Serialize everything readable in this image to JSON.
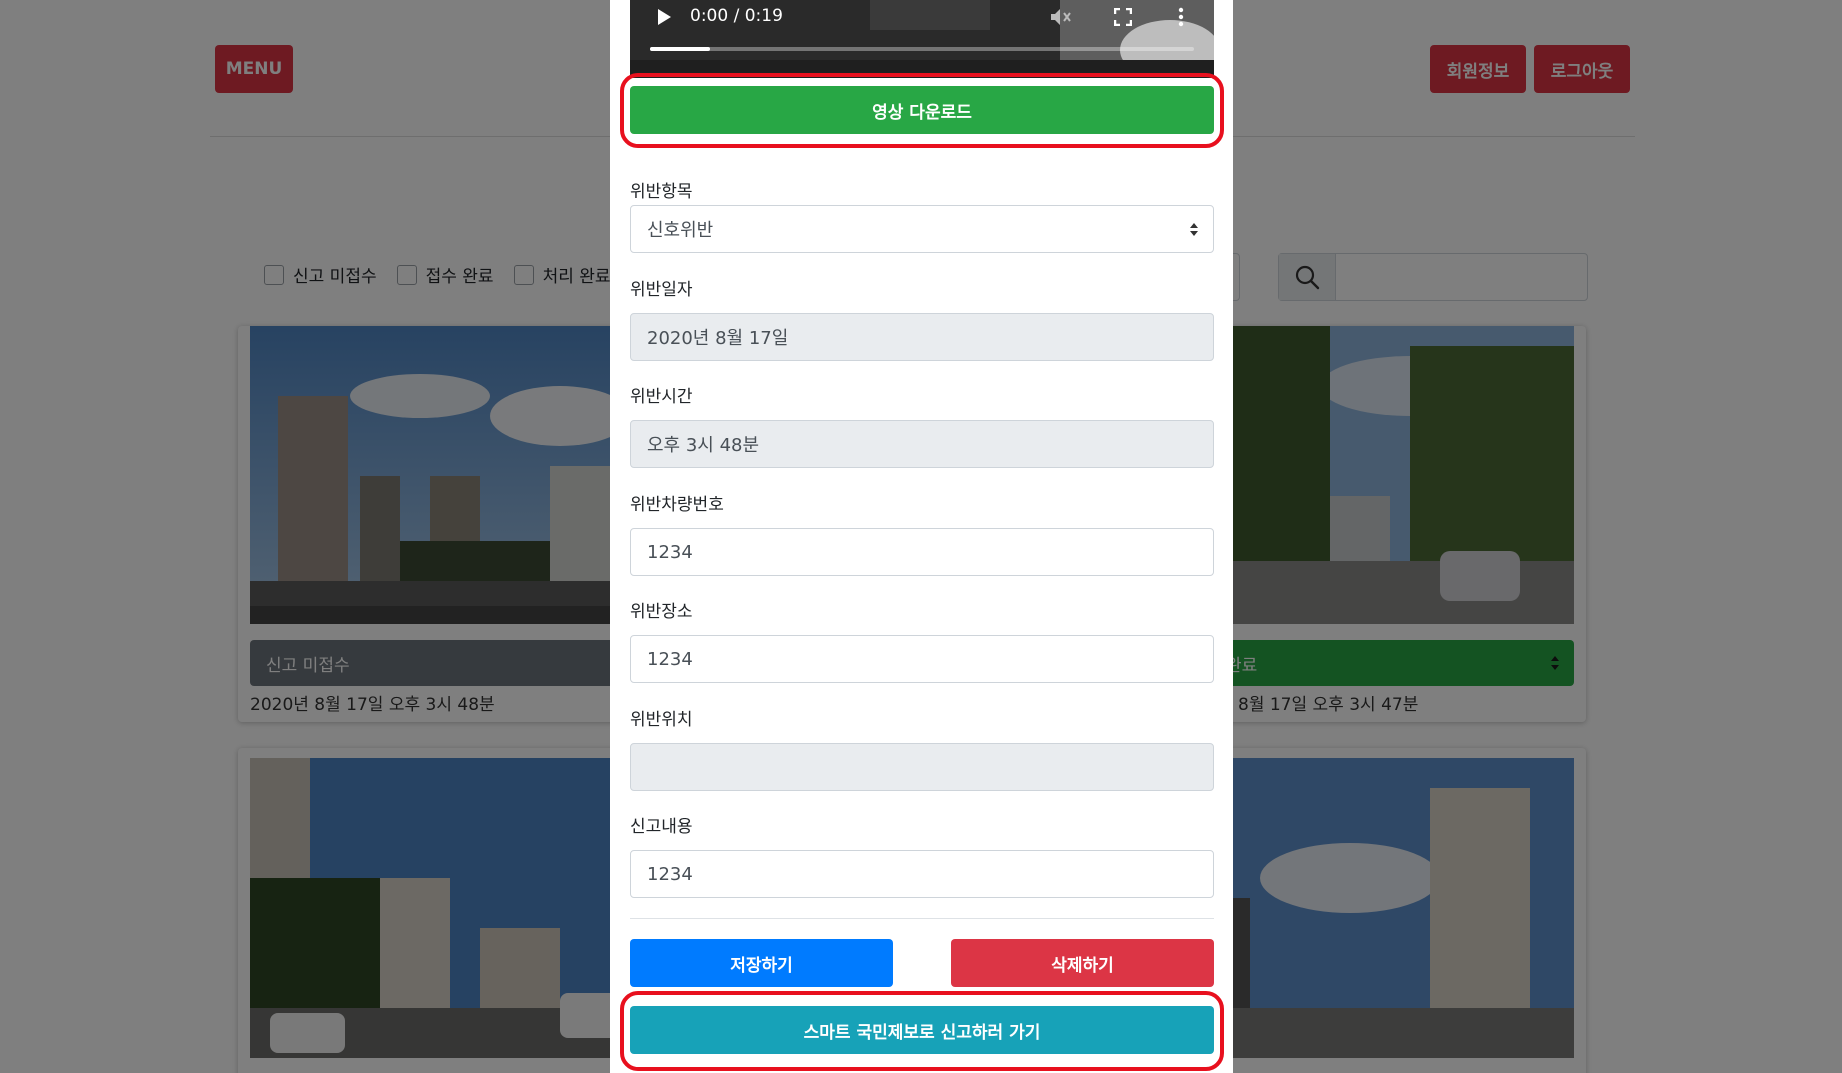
{
  "header": {
    "menu_label": "MENU",
    "member_info_label": "회원정보",
    "logout_label": "로그아웃"
  },
  "filters": [
    {
      "label": "신고 미접수"
    },
    {
      "label": "접수 완료"
    },
    {
      "label": "처리 완료"
    }
  ],
  "cards": [
    {
      "status": "신고 미접수",
      "datetime": "2020년 8월 17일 오후 3시 48분",
      "status_color": "#6c757d"
    },
    {
      "status": "완료",
      "datetime": "8월 17일 오후 3시 47분",
      "status_color": "#28a745"
    }
  ],
  "colors": {
    "danger": "#dc3545",
    "success": "#28a745",
    "primary": "#007bff",
    "info": "#17a2b8",
    "highlight": "#e8101e"
  },
  "modal": {
    "video": {
      "time": "0:00 / 0:19",
      "progress": 0.11,
      "icons": [
        "play-icon",
        "volume-icon",
        "fullscreen-icon",
        "more-options-icon"
      ]
    },
    "download_label": "영상 다운로드",
    "fields": {
      "violation_type": {
        "label": "위반항목",
        "value": "신호위반"
      },
      "violation_date": {
        "label": "위반일자",
        "value": "2020년 8월 17일"
      },
      "violation_time": {
        "label": "위반시간",
        "value": "오후 3시 48분"
      },
      "vehicle_number": {
        "label": "위반차량번호",
        "value": "1234"
      },
      "violation_place": {
        "label": "위반장소",
        "value": "1234"
      },
      "violation_location": {
        "label": "위반위치",
        "value": ""
      },
      "report_content": {
        "label": "신고내용",
        "value": "1234"
      }
    },
    "save_label": "저장하기",
    "delete_label": "삭제하기",
    "report_label": "스마트 국민제보로 신고하러 가기"
  }
}
